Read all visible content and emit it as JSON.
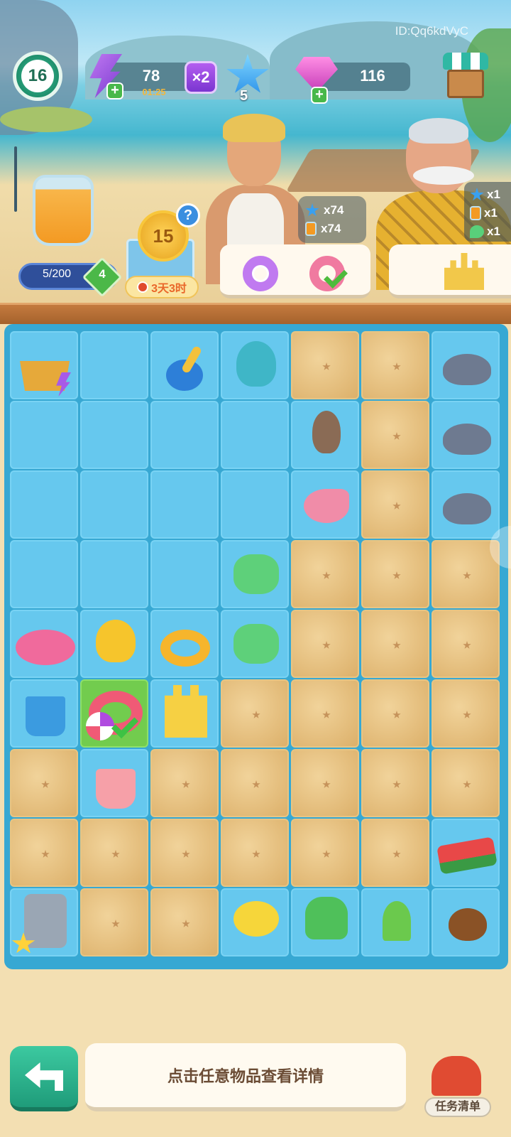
{
  "header": {
    "id_label": "ID:Qq6kdVyC",
    "level": "16",
    "energy": {
      "value": "78",
      "timer": "01:25",
      "multiplier": "×2",
      "icon": "energy-bolt-icon"
    },
    "stars": {
      "count": "5",
      "icon": "star-icon"
    },
    "gems": {
      "value": "116",
      "icon": "gem-icon"
    },
    "shop_icon": "shop-stall-icon"
  },
  "jar": {
    "progress_text": "5/200",
    "level": "4",
    "progress_fraction": 0.025
  },
  "event": {
    "coin_value": "15",
    "help_symbol": "?",
    "timer": "3天3时"
  },
  "rewards_bubble": [
    {
      "icon": "star-icon",
      "amount": "x74"
    },
    {
      "icon": "jar-icon",
      "amount": "x74"
    }
  ],
  "side_rewards": [
    {
      "icon": "star-icon",
      "amount": "x1"
    },
    {
      "icon": "jar-icon",
      "amount": "x1"
    },
    {
      "icon": "leaf-icon",
      "amount": "x1"
    }
  ],
  "orders": [
    {
      "items": [
        "swim-ring-purple-icon",
        "swim-ring-beachball-icon"
      ],
      "completed": [
        false,
        true
      ]
    },
    {
      "items": [
        "sand-castle-icon"
      ]
    }
  ],
  "board": {
    "rows": 9,
    "cols": 7,
    "cells": [
      [
        "basket",
        "water",
        "shovel",
        "parrot",
        "sand",
        "sand",
        "rock"
      ],
      [
        "water",
        "water",
        "water",
        "water",
        "bird",
        "sand",
        "rock"
      ],
      [
        "water",
        "water",
        "water",
        "water",
        "shell",
        "sand",
        "rock-plant"
      ],
      [
        "water",
        "water",
        "water",
        "leaf",
        "sand",
        "sand",
        "sand"
      ],
      [
        "flamingo",
        "duck",
        "duckring",
        "leaf",
        "sand",
        "sand",
        "sand"
      ],
      [
        "bucket",
        "ring-selected",
        "castle",
        "sand",
        "sand",
        "sand",
        "sand"
      ],
      [
        "sand",
        "juice",
        "sand",
        "sand",
        "sand",
        "sand",
        "sand"
      ],
      [
        "sand",
        "sand",
        "sand",
        "sand",
        "sand",
        "sand",
        "watermelon"
      ],
      [
        "juicer",
        "sand",
        "sand",
        "flower",
        "plant",
        "sprout",
        "seed"
      ]
    ]
  },
  "footer": {
    "hint": "点击任意物品查看详情",
    "task_label": "任务清单",
    "back_icon": "back-arrow-icon",
    "task_icon": "mailbox-icon"
  }
}
